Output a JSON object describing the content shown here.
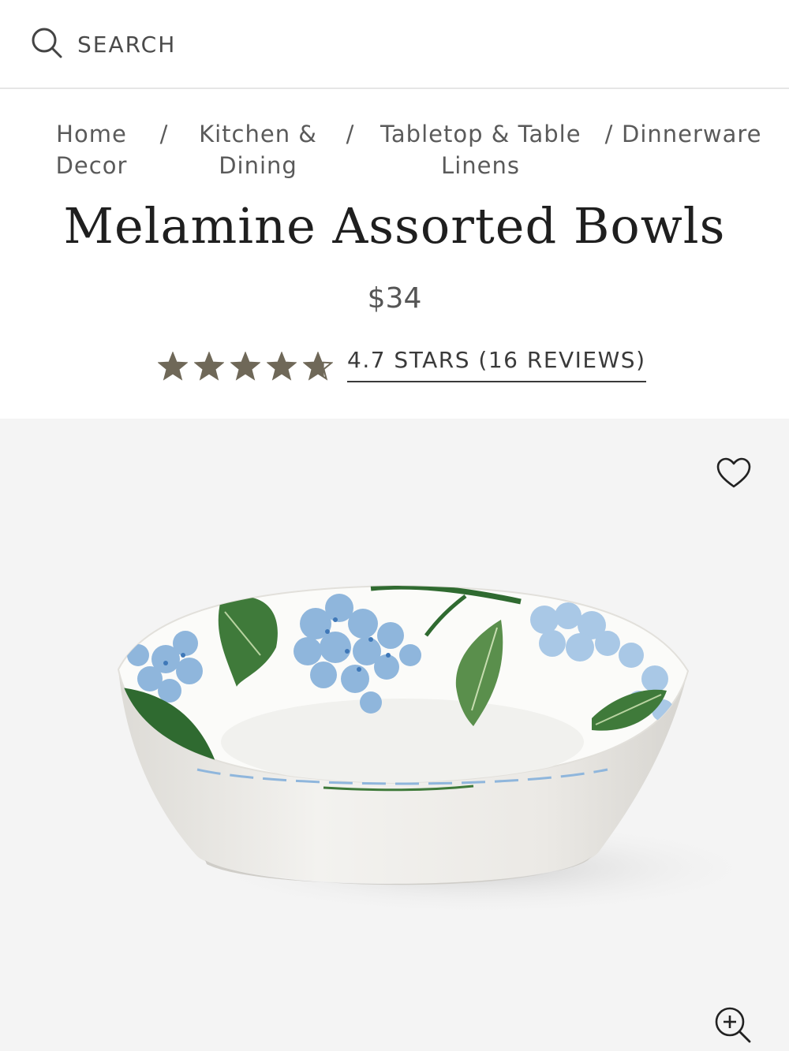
{
  "header": {
    "search_label": "SEARCH",
    "search_icon": "search-icon"
  },
  "breadcrumb": {
    "items": [
      {
        "line1": "Home",
        "line2": "Decor"
      },
      {
        "line1": "Kitchen &",
        "line2": "Dining"
      },
      {
        "line1": "Tabletop & Table",
        "line2": "Linens"
      },
      {
        "line1": "Dinnerware",
        "line2": ""
      }
    ],
    "separator": "/"
  },
  "product": {
    "title": "Melamine Assorted Bowls",
    "price": "$34",
    "rating_value": 4.7,
    "rating_max": 5,
    "reviews_text": "4.7 STARS (16 REVIEWS)"
  },
  "gallery": {
    "wishlist_icon": "heart-outline-icon",
    "zoom_icon": "zoom-in-icon",
    "image": "hydrangea-print-bowl"
  },
  "colors": {
    "star": "#6f6858",
    "text": "#3a3a3a",
    "gallery_bg": "#f4f4f4",
    "hydrangea_blue": "#8fb6dc",
    "leaf_green": "#3f7a3a"
  }
}
